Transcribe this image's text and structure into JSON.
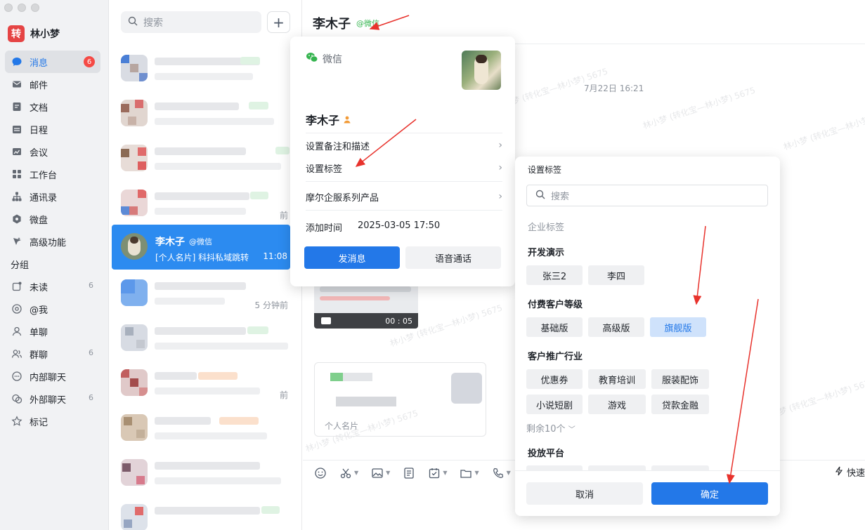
{
  "app": {
    "logo": "转",
    "user_name": "林小梦"
  },
  "nav": [
    {
      "label": "消息",
      "icon": "chat-bubble-icon",
      "badge": "6",
      "active": true
    },
    {
      "label": "邮件",
      "icon": "mail-icon"
    },
    {
      "label": "文档",
      "icon": "document-icon"
    },
    {
      "label": "日程",
      "icon": "calendar-icon"
    },
    {
      "label": "会议",
      "icon": "meeting-icon"
    },
    {
      "label": "工作台",
      "icon": "grid-icon"
    },
    {
      "label": "通讯录",
      "icon": "org-icon"
    },
    {
      "label": "微盘",
      "icon": "drive-icon"
    },
    {
      "label": "高级功能",
      "icon": "sparkle-icon"
    }
  ],
  "groups": {
    "title": "分组",
    "items": [
      {
        "label": "未读",
        "count": "6"
      },
      {
        "label": "@我",
        "count": ""
      },
      {
        "label": "单聊",
        "count": ""
      },
      {
        "label": "群聊",
        "count": "6"
      },
      {
        "label": "内部聊天",
        "count": ""
      },
      {
        "label": "外部聊天",
        "count": "6"
      },
      {
        "label": "标记",
        "count": ""
      }
    ]
  },
  "list": {
    "search_placeholder": "搜索",
    "add": "+",
    "selected": {
      "name": "李木子",
      "tag": "@微信",
      "message": "[个人名片] 科抖私域跳转",
      "time": "11:08"
    },
    "times": [
      "前",
      "5 分钟前",
      "前"
    ]
  },
  "chat": {
    "title": "李木子",
    "subtitle": "@微信",
    "date": "7月22日 16:21",
    "video_time": "00 : 05",
    "card_foot": "个人名片",
    "quick": "快速"
  },
  "watermark": "林小梦 (转化宝—林小梦) 5675",
  "profile": {
    "platform": "微信",
    "name": "李木子",
    "rows": [
      "设置备注和描述",
      "设置标签",
      "摩尔企服系列产品"
    ],
    "add_time_label": "添加时间",
    "add_time": "2025-03-05 17:50",
    "btn_message": "发消息",
    "btn_voice": "语音通话"
  },
  "tags_dialog": {
    "title": "设置标签",
    "search_placeholder": "搜索",
    "enterprise_label": "企业标签",
    "sections": [
      {
        "name": "开发演示",
        "tags": [
          "张三2",
          "李四"
        ]
      },
      {
        "name": "付费客户等级",
        "tags": [
          "基础版",
          "高级版",
          "旗舰版"
        ],
        "selected": "旗舰版"
      },
      {
        "name": "客户推广行业",
        "tags": [
          "优惠券",
          "教育培训",
          "服装配饰",
          "小说短剧",
          "游戏",
          "贷款金融"
        ]
      },
      {
        "name": "投放平台",
        "tags": []
      }
    ],
    "more": "剩余10个",
    "cancel": "取消",
    "confirm": "确定"
  },
  "colors": {
    "accent": "#2378e8",
    "badge": "#f54a45",
    "wechat_green": "#35b44f",
    "annotation": "#e8322c"
  }
}
